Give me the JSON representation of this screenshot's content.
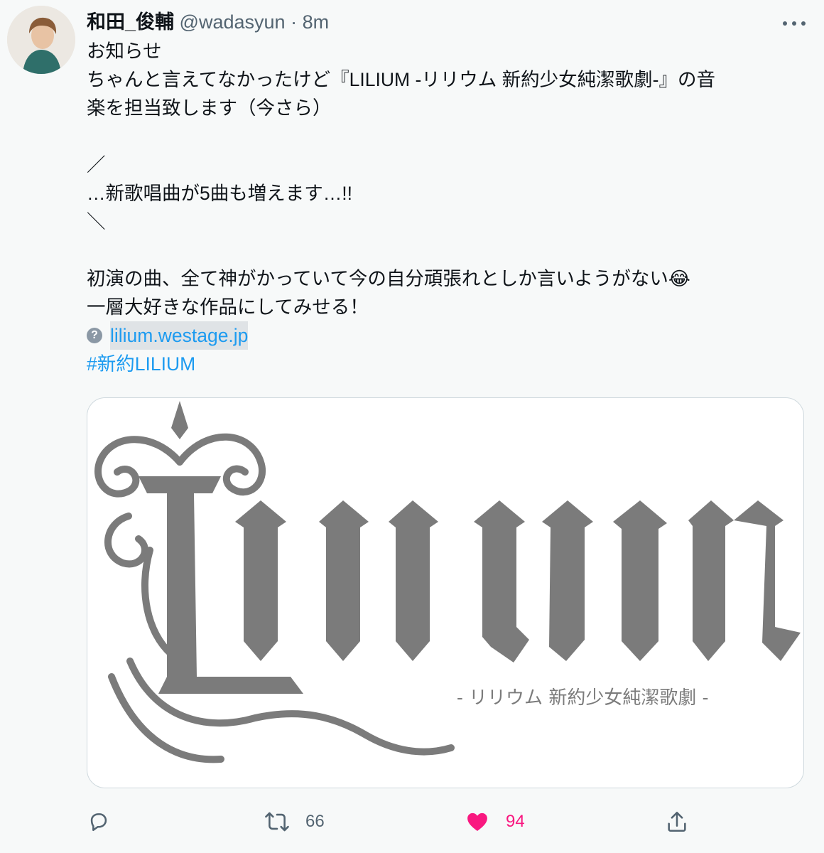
{
  "tweet": {
    "author_name": "和田_俊輔",
    "handle": "@wadasyun",
    "separator": "·",
    "time": "8m",
    "lines": [
      "お知らせ",
      "ちゃんと言えてなかったけど『LILIUM -リリウム 新約少女純潔歌劇-』の音",
      "楽を担当致します（今さら）",
      "",
      "／",
      "…新歌唱曲が5曲も増えます…!!",
      "＼",
      "",
      "初演の曲、全て神がかっていて今の自分頑張れとしか言いようがない😂",
      "一層大好きな作品にしてみせる！"
    ],
    "link_icon": "?",
    "link_text": "lilium.westage.jp",
    "hashtag": "#新約LILIUM"
  },
  "card": {
    "logo_text": "Lilium",
    "subtitle": "- リリウム 新約少女純潔歌劇 -",
    "logo_color": "#7b7b7b"
  },
  "actions": {
    "reply_count": "",
    "retweet_count": "66",
    "like_count": "94",
    "like_color": "#f91880",
    "icons": [
      "reply-icon",
      "retweet-icon",
      "heart-icon",
      "share-icon"
    ]
  }
}
